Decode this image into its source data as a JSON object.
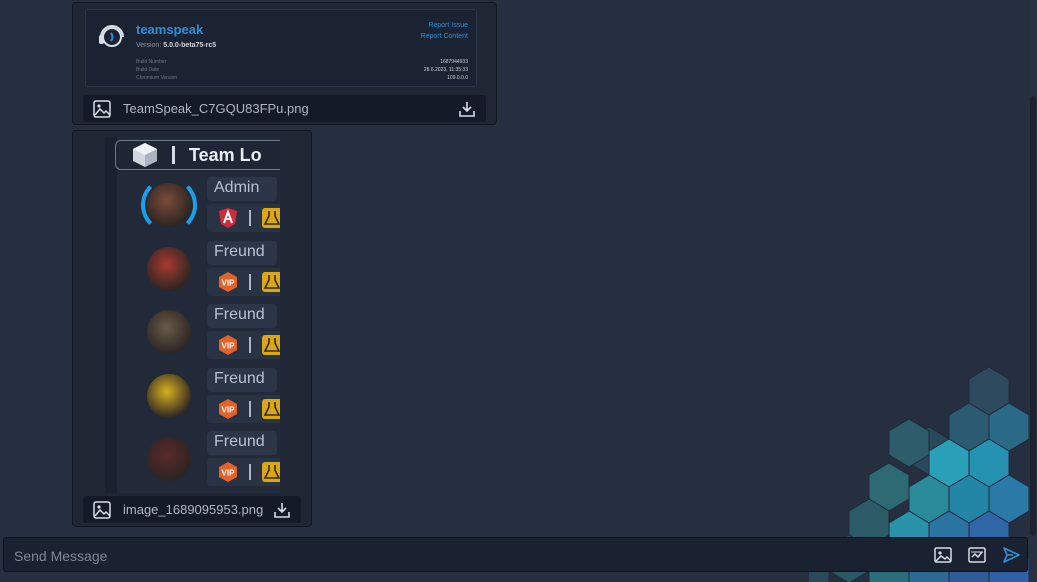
{
  "attachments": [
    {
      "file_name": "TeamSpeak_C7GQU83FPu.png",
      "preview": {
        "brand": "teamspeak",
        "version_label": "Version:",
        "version_value": "5.0.0-beta75-rc5",
        "meta_labels": [
          "Build Number",
          "Build Date",
          "Chromium Version"
        ],
        "meta_values": [
          "1687944933",
          "28.6.2023, 11:35:33",
          "109.0.0.0"
        ],
        "links": [
          "Report Issue",
          "Report Content"
        ]
      }
    },
    {
      "file_name": "image_1689095953.png",
      "preview": {
        "header_title": "Team Lo",
        "members": [
          {
            "role": "Admin",
            "badge": "angular-a",
            "avatar_color": "#7a4a3a"
          },
          {
            "role": "Freund",
            "badge": "vip",
            "avatar_color": "#a83a30"
          },
          {
            "role": "Freund",
            "badge": "vip",
            "avatar_color": "#6a5a4a"
          },
          {
            "role": "Freund",
            "badge": "vip",
            "avatar_color": "#d9b020"
          },
          {
            "role": "Freund",
            "badge": "vip",
            "avatar_color": "#5a2a2a"
          }
        ]
      }
    }
  ],
  "composer": {
    "placeholder": "Send Message",
    "icons": [
      "image-icon",
      "gif-icon",
      "send-icon"
    ]
  },
  "colors": {
    "background": "#262f40",
    "accent": "#2f8fd5",
    "send": "#2f8fd5"
  }
}
